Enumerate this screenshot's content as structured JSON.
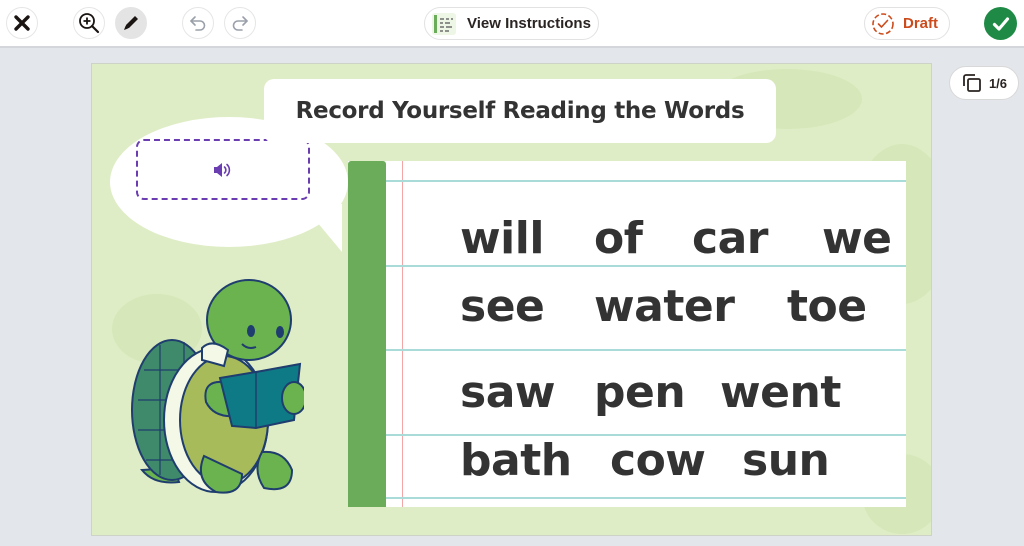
{
  "toolbar": {
    "close_label": "Close",
    "zoom_label": "Zoom in",
    "pen_label": "Draw",
    "undo_label": "Undo",
    "redo_label": "Redo",
    "instructions_label": "View Instructions",
    "draft_label": "Draft",
    "submit_label": "Submit"
  },
  "colors": {
    "accent_green": "#1e8a45",
    "draft_orange": "#cc4b1c",
    "audio_purple": "#6a3db0",
    "slide_bg": "#dfedc6",
    "spine_green": "#6aac5a"
  },
  "pager": {
    "current": 1,
    "total": 6,
    "label": "1/6"
  },
  "slide": {
    "title": "Record Yourself Reading the Words",
    "audio_icon": "speaker-icon",
    "word_rows": [
      [
        "will",
        "of",
        "car",
        "we"
      ],
      [
        "see",
        "water",
        "toe"
      ],
      [
        "saw",
        "pen",
        "went"
      ],
      [
        "bath",
        "cow",
        "sun"
      ]
    ]
  }
}
